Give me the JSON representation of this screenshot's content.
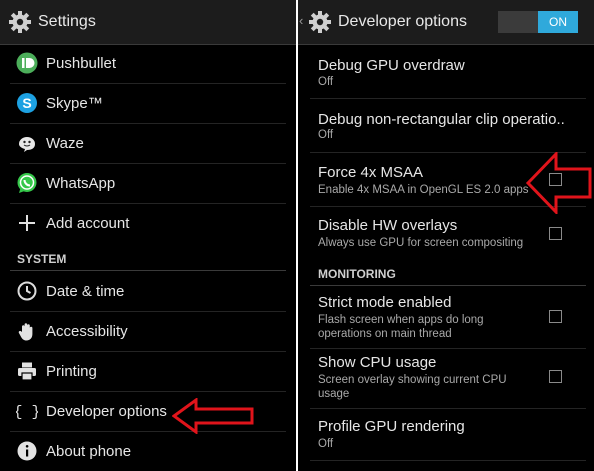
{
  "left": {
    "title": "Settings",
    "accounts": [
      {
        "label": "Pushbullet",
        "icon": "pushbullet-icon"
      },
      {
        "label": "Skype™",
        "icon": "skype-icon"
      },
      {
        "label": "Waze",
        "icon": "waze-icon"
      },
      {
        "label": "WhatsApp",
        "icon": "whatsapp-icon"
      },
      {
        "label": "Add account",
        "icon": "plus-icon"
      }
    ],
    "system_header": "SYSTEM",
    "system": [
      {
        "label": "Date & time",
        "icon": "clock-icon"
      },
      {
        "label": "Accessibility",
        "icon": "hand-icon"
      },
      {
        "label": "Printing",
        "icon": "printer-icon"
      },
      {
        "label": "Developer options",
        "icon": "braces-icon"
      },
      {
        "label": "About phone",
        "icon": "info-icon"
      }
    ]
  },
  "right": {
    "title": "Developer options",
    "toggle_label": "ON",
    "items": [
      {
        "title": "Debug GPU overdraw",
        "subtitle": "Off"
      },
      {
        "title": "Debug non-rectangular clip operatio..",
        "subtitle": "Off"
      },
      {
        "title": "Force 4x MSAA",
        "subtitle": "Enable 4x MSAA in OpenGL ES 2.0 apps"
      },
      {
        "title": "Disable HW overlays",
        "subtitle": "Always use GPU for screen compositing"
      }
    ],
    "monitoring_header": "MONITORING",
    "monitoring": [
      {
        "title": "Strict mode enabled",
        "subtitle_1": "Flash screen when apps do long",
        "subtitle_2": "operations on main thread"
      },
      {
        "title": "Show CPU usage",
        "subtitle_1": "Screen overlay showing current CPU",
        "subtitle_2": "usage"
      },
      {
        "title": "Profile GPU rendering",
        "subtitle": "Off"
      }
    ]
  },
  "colors": {
    "accent": "#2fa9db",
    "annotation": "#e0141b",
    "background": "#000000"
  }
}
